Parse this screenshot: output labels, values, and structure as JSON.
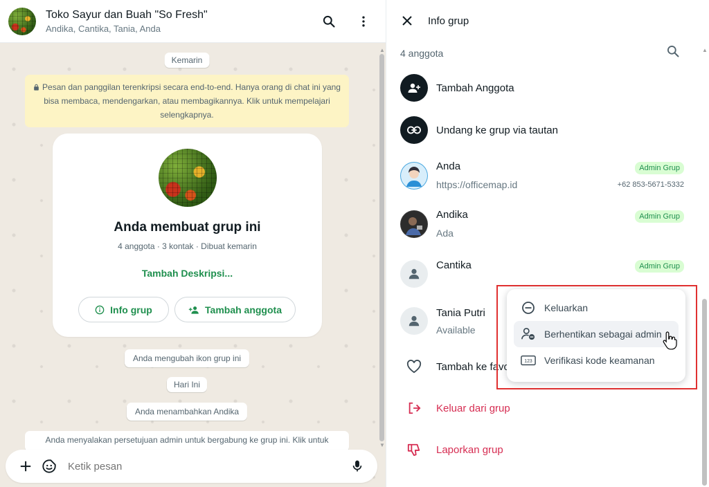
{
  "chat": {
    "title": "Toko Sayur dan Buah \"So Fresh\"",
    "participants": "Andika, Cantika, Tania, Anda",
    "date_yesterday": "Kemarin",
    "encryption_notice": "Pesan dan panggilan terenkripsi secara end-to-end. Hanya orang di chat ini yang bisa membaca, mendengarkan, atau membagikannya. Klik untuk mempelajari selengkapnya.",
    "card": {
      "title": "Anda membuat grup ini",
      "subtitle": "4 anggota · 3 kontak · Dibuat kemarin",
      "add_description": "Tambah Deskripsi...",
      "info_button": "Info grup",
      "add_member_button": "Tambah anggota"
    },
    "msg_icon_changed": "Anda mengubah ikon grup ini",
    "date_today": "Hari Ini",
    "msg_added": "Anda menambahkan Andika",
    "msg_admin_approval": "Anda menyalakan persetujuan admin untuk bergabung ke grup ini. Klik untuk",
    "composer_placeholder": "Ketik pesan"
  },
  "info": {
    "title": "Info grup",
    "members_count": "4 anggota",
    "add_member": "Tambah Anggota",
    "invite_link": "Undang ke grup via tautan",
    "members": [
      {
        "name": "Anda",
        "status": "https://officemap.id",
        "badge": "Admin Grup",
        "phone": "+62 853-5671-5332"
      },
      {
        "name": "Andika",
        "status": "Ada",
        "badge": "Admin Grup"
      },
      {
        "name": "Cantika",
        "status": "",
        "badge": "Admin Grup"
      },
      {
        "name": "Tania Putri",
        "status": "Available"
      }
    ],
    "add_favorite": "Tambah ke favorit",
    "leave_group": "Keluar dari grup",
    "report_group": "Laporkan grup"
  },
  "menu": {
    "items": [
      {
        "label": "Keluarkan",
        "icon": "minus-circle-icon"
      },
      {
        "label": "Berhentikan sebagai admin",
        "icon": "remove-admin-icon"
      },
      {
        "label": "Verifikasi kode keamanan",
        "icon": "security-code-icon"
      }
    ]
  },
  "colors": {
    "accent_green": "#1f8f4e",
    "danger_red": "#d62d52",
    "highlight_red": "#e03030",
    "notice_yellow": "#fdf4c5",
    "chat_bg": "#efeae2"
  }
}
